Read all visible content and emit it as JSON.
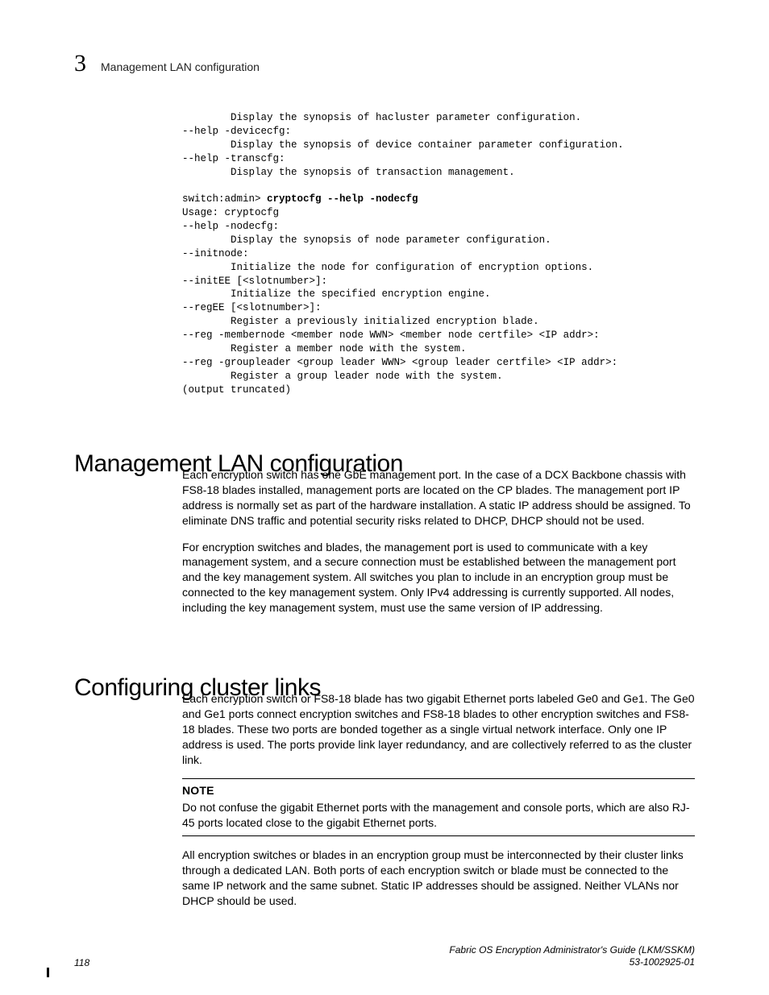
{
  "header": {
    "chapter_number": "3",
    "running_title": "Management LAN configuration"
  },
  "code": {
    "l01": "        Display the synopsis of hacluster parameter configuration.",
    "l02": "--help -devicecfg:",
    "l03": "        Display the synopsis of device container parameter configuration.",
    "l04": "--help -transcfg:",
    "l05": "        Display the synopsis of transaction management.",
    "blank1": "",
    "l06a": "switch:admin> ",
    "l06b": "cryptocfg --help -nodecfg",
    "l07": "Usage: cryptocfg",
    "l08": "--help -nodecfg:",
    "l09": "        Display the synopsis of node parameter configuration.",
    "l10": "--initnode:",
    "l11": "        Initialize the node for configuration of encryption options.",
    "l12": "--initEE [<slotnumber>]:",
    "l13": "        Initialize the specified encryption engine.",
    "l14": "--regEE [<slotnumber>]:",
    "l15": "        Register a previously initialized encryption blade.",
    "l16": "--reg -membernode <member node WWN> <member node certfile> <IP addr>:",
    "l17": "        Register a member node with the system.",
    "l18": "--reg -groupleader <group leader WWN> <group leader certfile> <IP addr>:",
    "l19": "        Register a group leader node with the system.",
    "l20": "(output truncated)"
  },
  "section1": {
    "heading": "Management LAN configuration",
    "p1": "Each encryption switch has one GbE management port. In the case of a DCX Backbone chassis with FS8-18 blades installed, management ports are located on the CP blades. The management port IP address is normally set as part of the hardware installation. A static IP address should be assigned. To eliminate DNS traffic and potential security risks related to DHCP, DHCP should not be used.",
    "p2": "For encryption switches and blades, the management port is used to communicate with a key management system, and a secure connection must be established between the management port and the key management system. All switches you plan to include in an encryption group must be connected to the key management system. Only IPv4 addressing is currently supported. All nodes, including the key management system, must use the same version of IP addressing."
  },
  "section2": {
    "heading": "Configuring cluster links",
    "p1": "Each encryption switch or FS8-18 blade has two gigabit Ethernet ports labeled Ge0 and Ge1. The Ge0 and Ge1 ports connect encryption switches and FS8-18 blades to other encryption switches and FS8-18 blades. These two ports are bonded together as a single virtual network interface. Only one IP address is used. The ports provide link layer redundancy, and are collectively referred to as the cluster link.",
    "note_label": "NOTE",
    "note_text": "Do not confuse the gigabit Ethernet ports with the management and console ports, which are also RJ-45 ports located close to the gigabit Ethernet ports.",
    "p2": "All encryption switches or blades in an encryption group must be interconnected by their cluster links through a dedicated LAN. Both ports of each encryption switch or blade must be connected to the same IP network and the same subnet. Static IP addresses should be assigned. Neither VLANs nor DHCP should be used."
  },
  "footer": {
    "page_number": "118",
    "doc_title": "Fabric OS Encryption Administrator's Guide  (LKM/SSKM)",
    "doc_number": "53-1002925-01"
  }
}
